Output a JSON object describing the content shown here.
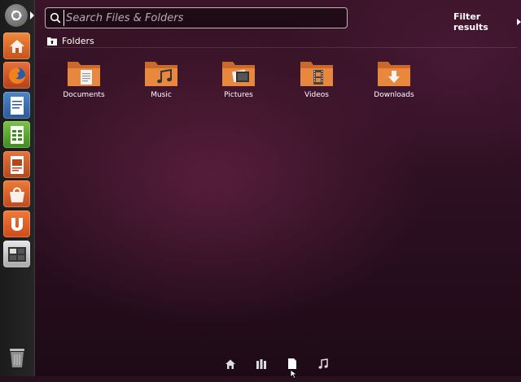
{
  "search": {
    "placeholder": "Search Files & Folders",
    "value": ""
  },
  "filter": {
    "label": "Filter results"
  },
  "category": {
    "title": "Folders"
  },
  "folders": [
    {
      "label": "Documents",
      "icon": "documents-folder-icon"
    },
    {
      "label": "Music",
      "icon": "music-folder-icon"
    },
    {
      "label": "Pictures",
      "icon": "pictures-folder-icon"
    },
    {
      "label": "Videos",
      "icon": "videos-folder-icon"
    },
    {
      "label": "Downloads",
      "icon": "downloads-folder-icon"
    }
  ],
  "launcher": {
    "items": [
      {
        "name": "dash-home-icon"
      },
      {
        "name": "home-folder-icon"
      },
      {
        "name": "firefox-icon"
      },
      {
        "name": "writer-icon"
      },
      {
        "name": "calc-icon"
      },
      {
        "name": "impress-icon"
      },
      {
        "name": "software-center-icon"
      },
      {
        "name": "ubuntu-one-icon"
      },
      {
        "name": "workspace-switcher-icon"
      },
      {
        "name": "trash-icon"
      }
    ]
  },
  "lenses": [
    {
      "name": "home-lens-icon"
    },
    {
      "name": "applications-lens-icon"
    },
    {
      "name": "files-lens-icon",
      "active": true
    },
    {
      "name": "music-lens-icon"
    }
  ],
  "colors": {
    "accent": "#dd4814",
    "folder": "#e3873f",
    "launcher_bg": "#1f1f1f"
  }
}
